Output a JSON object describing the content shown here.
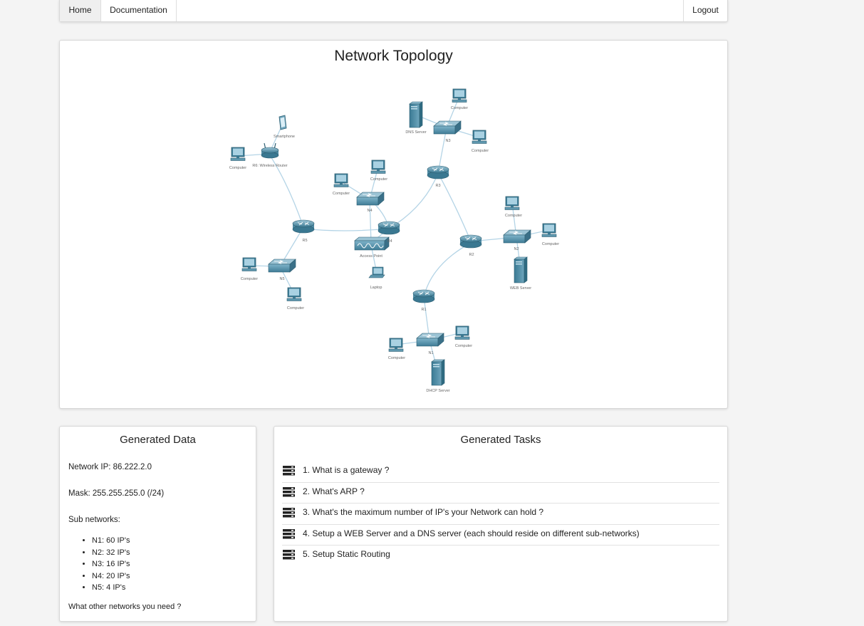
{
  "nav": {
    "home": "Home",
    "documentation": "Documentation",
    "logout": "Logout"
  },
  "topology": {
    "title": "Network Topology",
    "labels": {
      "smartphone": "Smartphone",
      "computer": "Computer",
      "r6": "R6: Wireless Router",
      "dns_server": "DNS Server",
      "n3": "N3",
      "r3": "R3",
      "n4": "N4",
      "r5": "R5",
      "r4": "R4",
      "access_point": "Access Point",
      "laptop": "Laptop",
      "n5": "N5",
      "r2": "R2",
      "n2": "N2",
      "web_server": "WEB Server",
      "r1": "R1",
      "n1": "N1",
      "dhcp_server": "DHCP Server"
    }
  },
  "generated_data": {
    "title": "Generated Data",
    "network_ip": "Network IP: 86.222.2.0",
    "mask": "Mask: 255.255.255.0 (/24)",
    "subnets_label": "Sub networks:",
    "subnets": [
      "N1: 60 IP's",
      "N2: 32 IP's",
      "N3: 16 IP's",
      "N4: 20 IP's",
      "N5: 4 IP's"
    ],
    "footer": "What other networks you need ?"
  },
  "generated_tasks": {
    "title": "Generated Tasks",
    "tasks": [
      "1. What is a gateway ?",
      "2. What's ARP ?",
      "3. What's the maximum number of IP's your Network can hold ?",
      "4. Setup a WEB Server and a DNS server (each should reside on different sub-networks)",
      "5. Setup Static Routing"
    ]
  }
}
